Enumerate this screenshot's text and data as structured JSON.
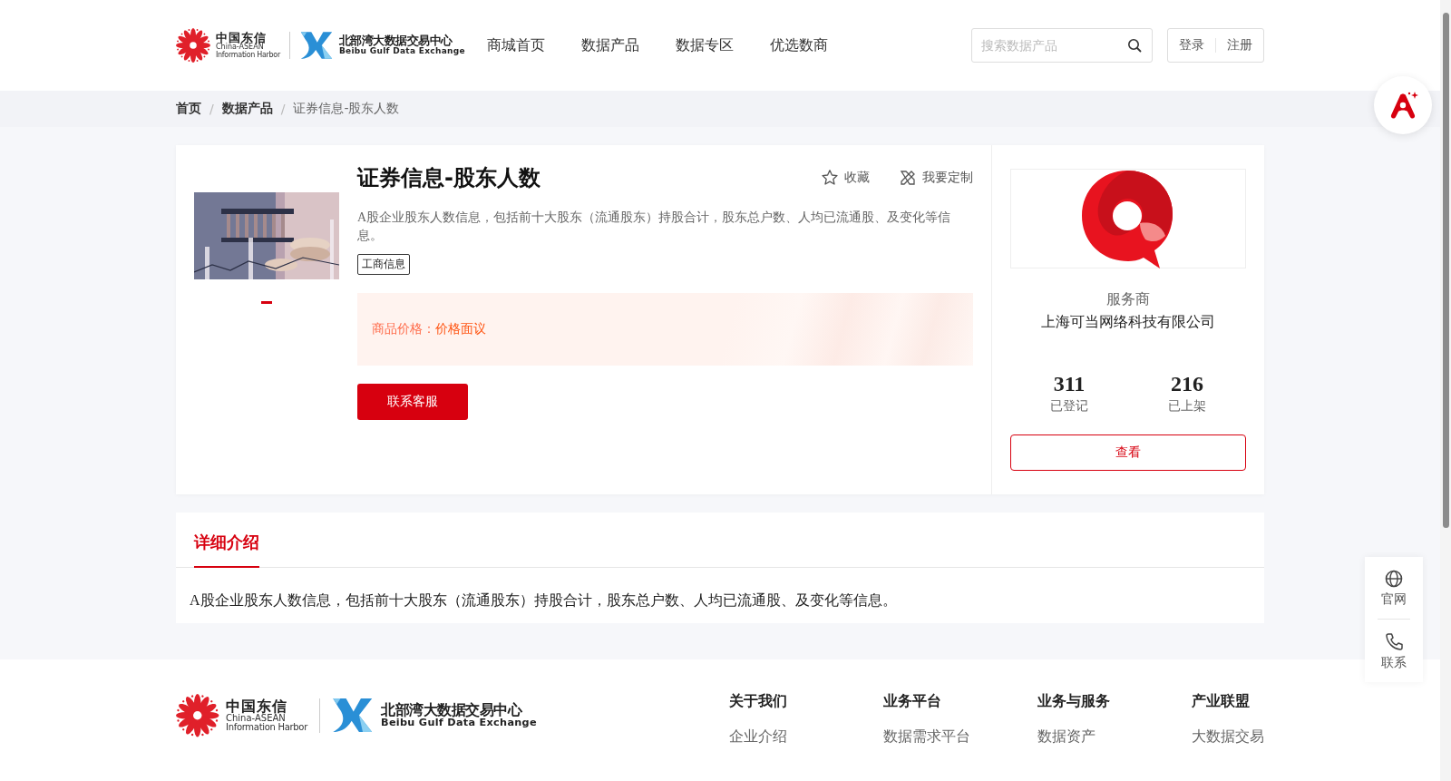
{
  "header": {
    "logo": {
      "cn": "中国东信",
      "en1": "China-ASEAN",
      "en2": "Information Harbor",
      "bgx_cn": "北部湾大数据交易中心",
      "bgx_en": "Beibu Gulf Data Exchange"
    },
    "nav": [
      {
        "label": "商城首页"
      },
      {
        "label": "数据产品"
      },
      {
        "label": "数据专区"
      },
      {
        "label": "优选数商"
      }
    ],
    "search": {
      "placeholder": "搜索数据产品"
    },
    "auth": [
      "登录",
      "注册"
    ]
  },
  "breadcrumb": {
    "separator": "/",
    "items": [
      "首页",
      "数据产品",
      "证券信息-股东人数"
    ]
  },
  "product": {
    "title": "证券信息-股东人数",
    "image": {
      "kind": "picture"
    },
    "actions": [
      {
        "kind": "favorite",
        "label": "收藏"
      },
      {
        "kind": "customize",
        "label": "我要定制"
      }
    ],
    "description": "A股企业股东人数信息，包括前十大股东（流通股东）持股合计，股东总户数、人均已流通股、及变化等信息。",
    "tags": [
      "工商信息"
    ],
    "price_label": "商品价格：",
    "price_value": "价格面议",
    "contact_button": "联系客服"
  },
  "provider": {
    "role": "服务商",
    "name": "上海可当网络科技有限公司",
    "stats": [
      {
        "value": "311",
        "label": "已登记"
      },
      {
        "value": "216",
        "label": "已上架"
      }
    ],
    "button": "查看"
  },
  "detail": {
    "tabs": [
      {
        "label": "详细介绍",
        "selected": true
      }
    ],
    "text": "A股企业股东人数信息，包括前十大股东（流通股东）持股合计，股东总户数、人均已流通股、及变化等信息。"
  },
  "footer": {
    "logo": {
      "cn": "中国东信",
      "en1": "China-ASEAN",
      "en2": "Information Harbor",
      "bgx_cn": "北部湾大数据交易中心",
      "bgx_en": "Beibu Gulf Data Exchange"
    },
    "columns": [
      {
        "heading": "关于我们",
        "links": [
          "企业介绍"
        ]
      },
      {
        "heading": "业务平台",
        "links": [
          "数据需求平台"
        ]
      },
      {
        "heading": "业务与服务",
        "links": [
          "数据资产"
        ]
      },
      {
        "heading": "产业联盟",
        "links": [
          "大数据交易"
        ]
      }
    ]
  },
  "side_tools": [
    {
      "kind": "globe",
      "label": "官网"
    },
    {
      "kind": "phone",
      "label": "联系"
    }
  ]
}
